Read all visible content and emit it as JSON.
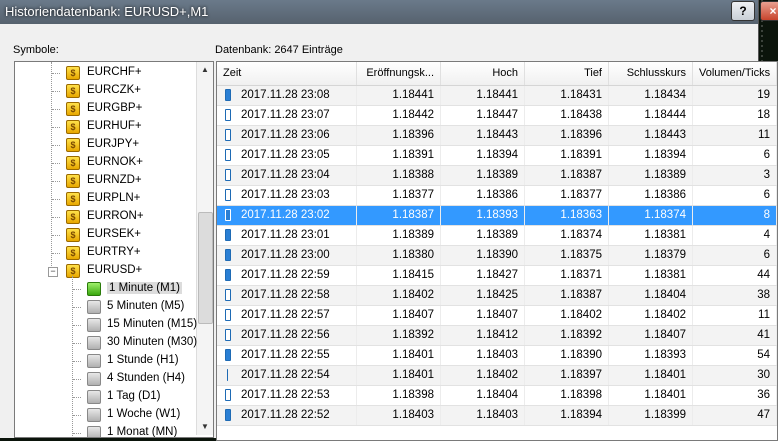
{
  "window": {
    "title": "Historiendatenbank: EURUSD+,M1",
    "help_button": "?",
    "close_button": "×"
  },
  "labels": {
    "symbols": "Symbole:",
    "database": "Datenbank: 2647 Einträge"
  },
  "symbols_tree": {
    "currencies": [
      "EURCHF+",
      "EURCZK+",
      "EURGBP+",
      "EURHUF+",
      "EURJPY+",
      "EURNOK+",
      "EURNZD+",
      "EURPLN+",
      "EURRON+",
      "EURSEK+",
      "EURTRY+"
    ],
    "expanded_symbol": "EURUSD+",
    "timeframes": [
      "1 Minute (M1)",
      "5 Minuten (M5)",
      "15 Minuten (M15)",
      "30 Minuten (M30)",
      "1 Stunde (H1)",
      "4 Stunden (H4)",
      "1 Tag (D1)",
      "1 Woche (W1)",
      "1 Monat (MN)"
    ],
    "selected_timeframe": "1 Minute (M1)",
    "symbol_icon_glyph": "$"
  },
  "table": {
    "headers": [
      "Zeit",
      "Eröffnungsk...",
      "Hoch",
      "Tief",
      "Schlusskurs",
      "Volumen/Ticks"
    ],
    "selected_row": 6,
    "rows": [
      {
        "candle": "bear",
        "time": "2017.11.28 23:08",
        "open": "1.18441",
        "high": "1.18441",
        "low": "1.18431",
        "close": "1.18434",
        "volume": "19"
      },
      {
        "candle": "bull",
        "time": "2017.11.28 23:07",
        "open": "1.18442",
        "high": "1.18447",
        "low": "1.18438",
        "close": "1.18444",
        "volume": "18"
      },
      {
        "candle": "bull",
        "time": "2017.11.28 23:06",
        "open": "1.18396",
        "high": "1.18443",
        "low": "1.18396",
        "close": "1.18443",
        "volume": "11"
      },
      {
        "candle": "bull",
        "time": "2017.11.28 23:05",
        "open": "1.18391",
        "high": "1.18394",
        "low": "1.18391",
        "close": "1.18394",
        "volume": "6"
      },
      {
        "candle": "bull",
        "time": "2017.11.28 23:04",
        "open": "1.18388",
        "high": "1.18389",
        "low": "1.18387",
        "close": "1.18389",
        "volume": "3"
      },
      {
        "candle": "bull",
        "time": "2017.11.28 23:03",
        "open": "1.18377",
        "high": "1.18386",
        "low": "1.18377",
        "close": "1.18386",
        "volume": "6"
      },
      {
        "candle": "bear",
        "time": "2017.11.28 23:02",
        "open": "1.18387",
        "high": "1.18393",
        "low": "1.18363",
        "close": "1.18374",
        "volume": "8"
      },
      {
        "candle": "bear",
        "time": "2017.11.28 23:01",
        "open": "1.18389",
        "high": "1.18389",
        "low": "1.18374",
        "close": "1.18381",
        "volume": "4"
      },
      {
        "candle": "bear",
        "time": "2017.11.28 23:00",
        "open": "1.18380",
        "high": "1.18390",
        "low": "1.18375",
        "close": "1.18379",
        "volume": "6"
      },
      {
        "candle": "bear",
        "time": "2017.11.28 22:59",
        "open": "1.18415",
        "high": "1.18427",
        "low": "1.18371",
        "close": "1.18381",
        "volume": "44"
      },
      {
        "candle": "bull",
        "time": "2017.11.28 22:58",
        "open": "1.18402",
        "high": "1.18425",
        "low": "1.18387",
        "close": "1.18404",
        "volume": "38"
      },
      {
        "candle": "bull",
        "time": "2017.11.28 22:57",
        "open": "1.18407",
        "high": "1.18407",
        "low": "1.18402",
        "close": "1.18402",
        "volume": "11"
      },
      {
        "candle": "bull",
        "time": "2017.11.28 22:56",
        "open": "1.18392",
        "high": "1.18412",
        "low": "1.18392",
        "close": "1.18407",
        "volume": "41"
      },
      {
        "candle": "bear",
        "time": "2017.11.28 22:55",
        "open": "1.18401",
        "high": "1.18403",
        "low": "1.18390",
        "close": "1.18393",
        "volume": "54"
      },
      {
        "candle": "doji",
        "time": "2017.11.28 22:54",
        "open": "1.18401",
        "high": "1.18402",
        "low": "1.18397",
        "close": "1.18401",
        "volume": "30"
      },
      {
        "candle": "bull",
        "time": "2017.11.28 22:53",
        "open": "1.18398",
        "high": "1.18404",
        "low": "1.18398",
        "close": "1.18401",
        "volume": "36"
      },
      {
        "candle": "bear",
        "time": "2017.11.28 22:52",
        "open": "1.18403",
        "high": "1.18403",
        "low": "1.18394",
        "close": "1.18399",
        "volume": "47"
      }
    ]
  },
  "colors": {
    "selection": "#3399ff",
    "candle": "#2a7fd4",
    "symbol_icon": "#f0c020"
  }
}
